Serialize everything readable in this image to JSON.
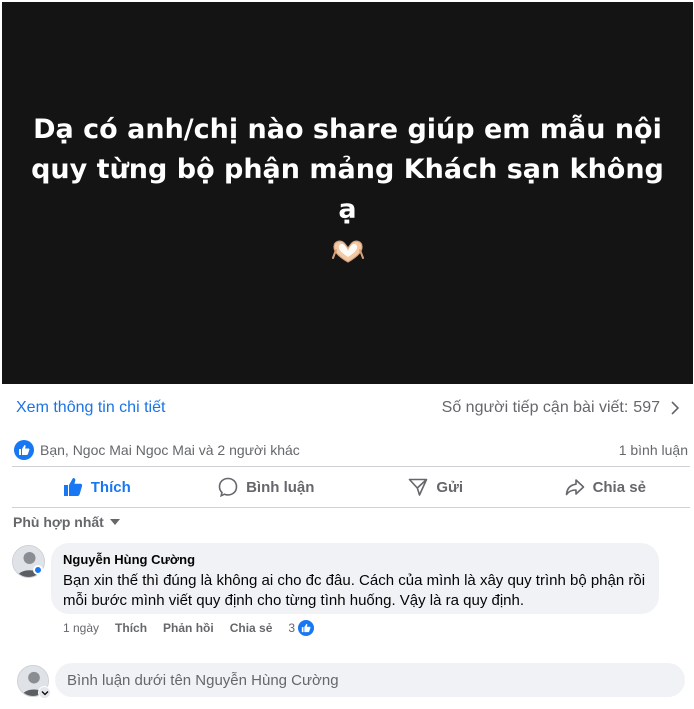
{
  "post": {
    "text": "Dạ có anh/chị nào share giúp em mẫu nội quy từng bộ phận mảng Khách sạn không ạ",
    "background_color": "#141414",
    "emoji": "heart-hands-icon"
  },
  "info": {
    "view_details": "Xem thông tin chi tiết",
    "reach_label": "Số người tiếp cận bài viết:",
    "reach_value": "597"
  },
  "reactions": {
    "reactors": "Bạn, Ngoc Mai Ngoc Mai và 2 người khác",
    "comment_count": "1 bình luận"
  },
  "actions": {
    "like": "Thích",
    "comment": "Bình luận",
    "send": "Gửi",
    "share": "Chia sẻ"
  },
  "sort": {
    "label": "Phù hợp nhất"
  },
  "comment": {
    "author": "Nguyễn Hùng Cường",
    "text": "Bạn xin thế thì đúng là không ai cho đc đâu. Cách của mình là xây quy trình bộ phận rồi mỗi bước mình viết quy định cho từng tình huống. Vậy là ra quy định.",
    "time": "1 ngày",
    "like": "Thích",
    "reply": "Phản hồi",
    "share": "Chia sẻ",
    "reaction_count": "3"
  },
  "composer": {
    "placeholder": "Bình luận dưới tên Nguyễn Hùng Cường"
  },
  "colors": {
    "accent": "#1877f2",
    "link": "#1b74e4",
    "muted": "#65676b",
    "bubble": "#f0f2f5"
  }
}
